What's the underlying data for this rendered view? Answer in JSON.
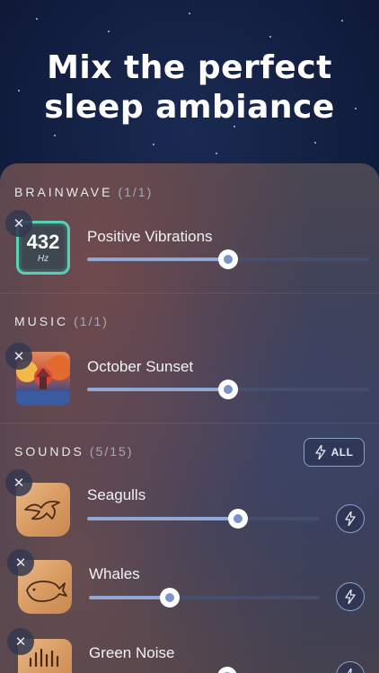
{
  "headline": {
    "line1": "Mix the perfect",
    "line2": "sleep ambiance"
  },
  "sections": {
    "brainwave": {
      "label": "BRAINWAVE",
      "count": "(1/1)"
    },
    "music": {
      "label": "MUSIC",
      "count": "(1/1)"
    },
    "sounds": {
      "label": "SOUNDS",
      "count": "(5/15)",
      "all_label": "ALL"
    }
  },
  "items": {
    "brainwave": {
      "tile_number": "432",
      "tile_unit": "Hz",
      "title": "Positive Vibrations",
      "volume": 0.5
    },
    "music": {
      "title": "October Sunset",
      "volume": 0.5
    },
    "seagulls": {
      "title": "Seagulls",
      "volume": 0.65
    },
    "whales": {
      "title": "Whales",
      "volume": 0.35
    },
    "green_noise": {
      "title": "Green Noise",
      "volume": 0.6
    }
  },
  "colors": {
    "slider_fill": "#8fa8d6",
    "hz_border": "#57d1b5",
    "accent_outline": "#8da0c8"
  },
  "icons": {
    "remove": "close-icon",
    "bolt": "lightning-bolt-icon",
    "seagull": "seagull-icon",
    "whale": "whale-icon",
    "noise": "sound-wave-icon"
  }
}
